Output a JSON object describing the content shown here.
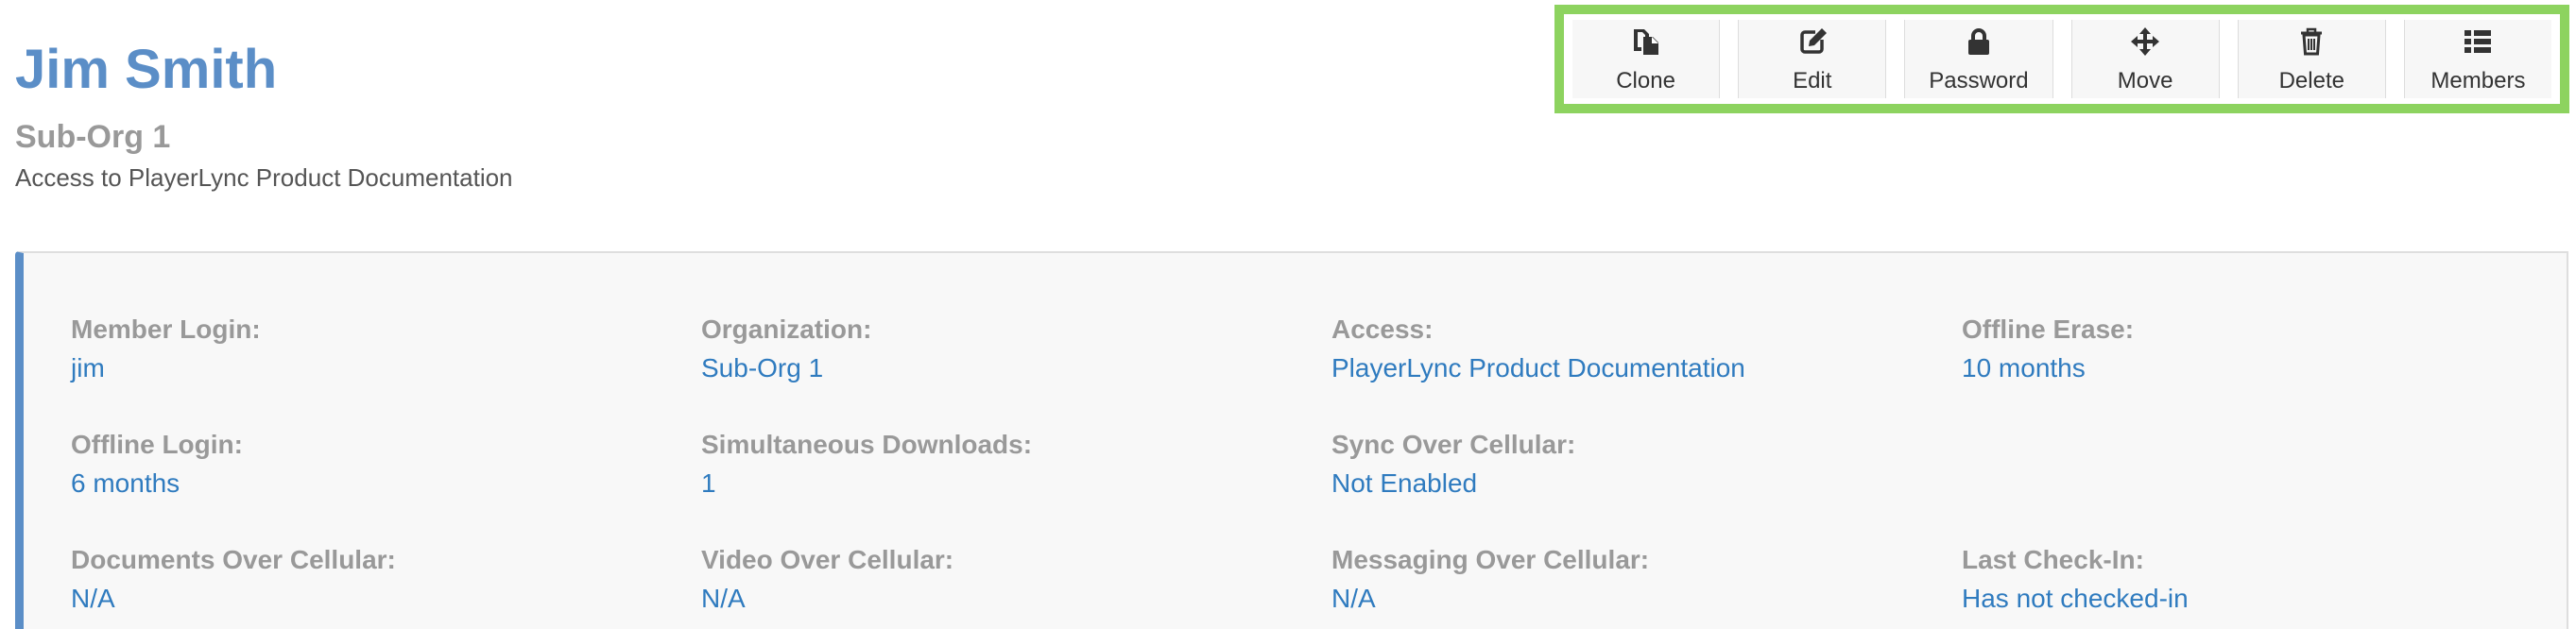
{
  "header": {
    "user_name": "Jim Smith",
    "organization": "Sub-Org 1",
    "access_description": "Access to PlayerLync Product Documentation"
  },
  "toolbar": {
    "clone_label": "Clone",
    "edit_label": "Edit",
    "password_label": "Password",
    "move_label": "Move",
    "delete_label": "Delete",
    "members_label": "Members"
  },
  "details": {
    "member_login": {
      "label": "Member Login:",
      "value": "jim"
    },
    "organization": {
      "label": "Organization:",
      "value": "Sub-Org 1"
    },
    "access": {
      "label": "Access:",
      "value": "PlayerLync Product Documentation"
    },
    "offline_erase": {
      "label": "Offline Erase:",
      "value": "10 months"
    },
    "offline_login": {
      "label": "Offline Login:",
      "value": "6 months"
    },
    "simultaneous_downloads": {
      "label": "Simultaneous Downloads:",
      "value": "1"
    },
    "sync_over_cellular": {
      "label": "Sync Over Cellular:",
      "value": "Not Enabled"
    },
    "documents_over_cellular": {
      "label": "Documents Over Cellular:",
      "value": "N/A"
    },
    "video_over_cellular": {
      "label": "Video Over Cellular:",
      "value": "N/A"
    },
    "messaging_over_cellular": {
      "label": "Messaging Over Cellular:",
      "value": "N/A"
    },
    "last_check_in": {
      "label": "Last Check-In:",
      "value": "Has not checked-in"
    }
  },
  "icons": [
    "clone-icon",
    "edit-icon",
    "lock-icon",
    "move-icon",
    "trash-icon",
    "list-icon"
  ],
  "colors": {
    "title_blue": "#5b8ec7",
    "link_blue": "#2f7bbf",
    "toolbar_highlight": "#8dd35f",
    "label_gray": "#999999",
    "panel_background": "#f8f8f8"
  }
}
